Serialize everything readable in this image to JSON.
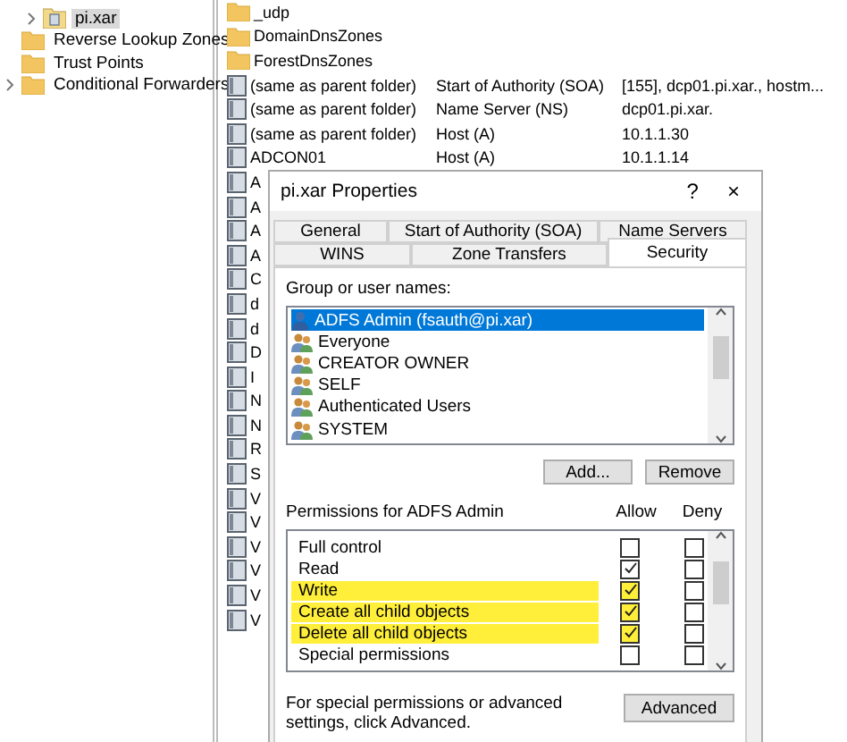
{
  "tree": [
    {
      "label": "pi.xar",
      "selected": true,
      "expandable": true,
      "kind": "zone"
    },
    {
      "label": "Reverse Lookup Zones",
      "selected": false,
      "expandable": false,
      "kind": "folder"
    },
    {
      "label": "Trust Points",
      "selected": false,
      "expandable": false,
      "kind": "folder"
    },
    {
      "label": "Conditional Forwarders",
      "selected": false,
      "expandable": true,
      "kind": "folder"
    }
  ],
  "records": [
    {
      "kind": "folder",
      "name": "_udp"
    },
    {
      "kind": "folder",
      "name": "DomainDnsZones"
    },
    {
      "kind": "folder",
      "name": "ForestDnsZones"
    },
    {
      "kind": "record",
      "name": "(same as parent folder)",
      "type": "Start of Authority (SOA)",
      "data": "[155], dcp01.pi.xar., hostm..."
    },
    {
      "kind": "record",
      "name": "(same as parent folder)",
      "type": "Name Server (NS)",
      "data": "dcp01.pi.xar."
    },
    {
      "kind": "record",
      "name": "(same as parent folder)",
      "type": "Host (A)",
      "data": "10.1.1.30"
    },
    {
      "kind": "record",
      "name": "ADCON01",
      "type": "Host (A)",
      "data": "10.1.1.14"
    },
    {
      "kind": "record",
      "name": "A"
    },
    {
      "kind": "record",
      "name": "A"
    },
    {
      "kind": "record",
      "name": "A"
    },
    {
      "kind": "record",
      "name": "A"
    },
    {
      "kind": "record",
      "name": "C"
    },
    {
      "kind": "record",
      "name": "d"
    },
    {
      "kind": "record",
      "name": "d"
    },
    {
      "kind": "record",
      "name": "D"
    },
    {
      "kind": "record",
      "name": "I"
    },
    {
      "kind": "record",
      "name": "N"
    },
    {
      "kind": "record",
      "name": "N"
    },
    {
      "kind": "record",
      "name": "R"
    },
    {
      "kind": "record",
      "name": "S"
    },
    {
      "kind": "record",
      "name": "V"
    },
    {
      "kind": "record",
      "name": "V"
    },
    {
      "kind": "record",
      "name": "V"
    },
    {
      "kind": "record",
      "name": "V"
    },
    {
      "kind": "record",
      "name": "V"
    },
    {
      "kind": "record",
      "name": "V"
    }
  ],
  "dialog": {
    "title": "pi.xar Properties",
    "help": "?",
    "close": "×",
    "tab_rows": [
      [
        {
          "label": "General",
          "selected": false
        },
        {
          "label": "Start of Authority (SOA)",
          "selected": false
        },
        {
          "label": "Name Servers",
          "selected": false
        }
      ],
      [
        {
          "label": "WINS",
          "selected": false
        },
        {
          "label": "Zone Transfers",
          "selected": false
        },
        {
          "label": "Security",
          "selected": true
        }
      ]
    ],
    "group_label": "Group or user names:",
    "groups": [
      {
        "kind": "user",
        "name": "ADFS Admin (fsauth@pi.xar)",
        "selected": true
      },
      {
        "kind": "group",
        "name": "Everyone",
        "selected": false
      },
      {
        "kind": "group",
        "name": "CREATOR OWNER",
        "selected": false
      },
      {
        "kind": "group",
        "name": "SELF",
        "selected": false
      },
      {
        "kind": "group",
        "name": "Authenticated Users",
        "selected": false
      },
      {
        "kind": "group",
        "name": "SYSTEM",
        "selected": false
      }
    ],
    "buttons": [
      "Add...",
      "Remove"
    ],
    "permissions_label": "Permissions for ADFS Admin",
    "allow_label": "Allow",
    "deny_label": "Deny",
    "permissions": [
      {
        "name": "Full control",
        "allow": false,
        "deny": false,
        "highlighted": false
      },
      {
        "name": "Read",
        "allow": true,
        "deny": false,
        "highlighted": false
      },
      {
        "name": "Write",
        "allow": true,
        "deny": false,
        "highlighted": true
      },
      {
        "name": "Create all child objects",
        "allow": true,
        "deny": false,
        "highlighted": true
      },
      {
        "name": "Delete all child objects",
        "allow": true,
        "deny": false,
        "highlighted": true
      },
      {
        "name": "Special permissions",
        "allow": false,
        "deny": false,
        "highlighted": false
      }
    ],
    "advanced_text": "For special permissions or advanced settings, click Advanced.",
    "advanced_button": "Advanced"
  }
}
